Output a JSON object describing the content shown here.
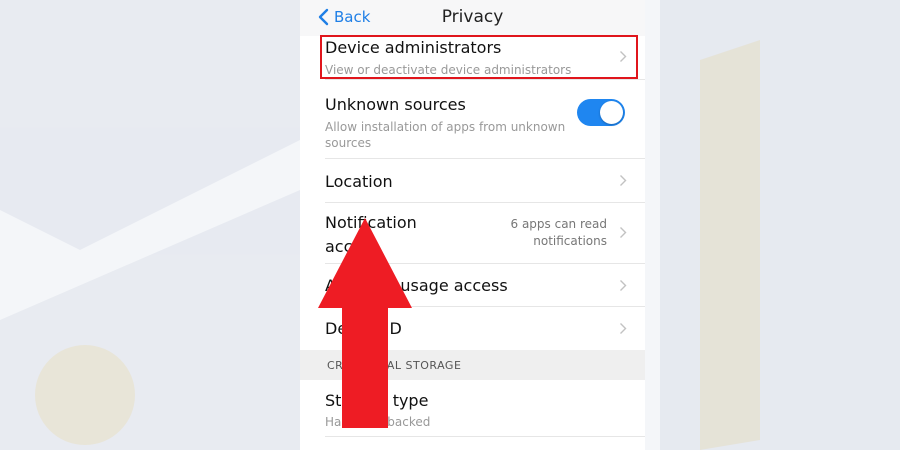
{
  "nav": {
    "back_label": "Back",
    "title": "Privacy"
  },
  "rows": {
    "device_admins": {
      "title": "Device administrators",
      "subtitle": "View or deactivate device administrators"
    },
    "unknown_sources": {
      "title": "Unknown sources",
      "subtitle_line1": "Allow installation of apps from unknown",
      "subtitle_line2": "sources",
      "toggle_on": true
    },
    "location": {
      "title": "Location"
    },
    "notification_access": {
      "title_line1": "Notification",
      "title_line2": "access",
      "value_line1": "6 apps can read",
      "value_line2": "notifications"
    },
    "app_usage_access": {
      "title": "App with usage access"
    },
    "device_id": {
      "title": "Device ID"
    }
  },
  "section": {
    "label": "CREDENTIAL STORAGE"
  },
  "storage_type": {
    "title": "Storage type",
    "subtitle": "Hardware-backed"
  },
  "colors": {
    "accent": "#1f86f0",
    "highlight": "#e0151c",
    "arrow": "#ee1c24"
  },
  "icons": {
    "back": "chevron-left-icon",
    "row": "chevron-right-icon",
    "annotation": "up-arrow-icon"
  }
}
